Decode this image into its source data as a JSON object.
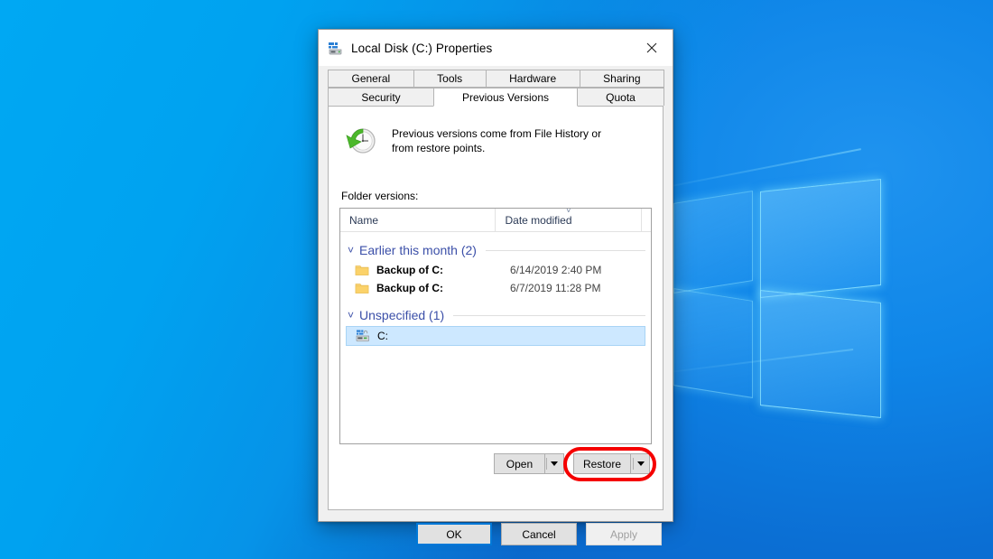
{
  "window": {
    "title": "Local Disk (C:) Properties",
    "icon": "hard-disk-icon",
    "close_label": "✕"
  },
  "tabs": {
    "row1": [
      {
        "label": "General",
        "active": false
      },
      {
        "label": "Tools",
        "active": false
      },
      {
        "label": "Hardware",
        "active": false
      },
      {
        "label": "Sharing",
        "active": false
      }
    ],
    "row2": [
      {
        "label": "Security",
        "active": false
      },
      {
        "label": "Previous Versions",
        "active": true
      },
      {
        "label": "Quota",
        "active": false
      }
    ]
  },
  "page": {
    "info_icon": "clock-restore-icon",
    "info_text": "Previous versions come from File History or from restore points.",
    "list_label": "Folder versions:"
  },
  "list": {
    "columns": [
      {
        "label": "Name",
        "sorted": false
      },
      {
        "label": "Date modified",
        "sorted": true,
        "sort_direction": "descending"
      }
    ],
    "groups": [
      {
        "label": "Earlier this month (2)",
        "expanded": true,
        "items": [
          {
            "icon": "folder-icon",
            "name": "Backup of C:",
            "date": "6/14/2019 2:40 PM",
            "selected": false
          },
          {
            "icon": "folder-icon",
            "name": "Backup of C:",
            "date": "6/7/2019 11:28 PM",
            "selected": false
          }
        ]
      },
      {
        "label": "Unspecified (1)",
        "expanded": true,
        "items": [
          {
            "icon": "drive-icon",
            "name": "C:",
            "date": "",
            "selected": true
          }
        ]
      }
    ]
  },
  "actions": {
    "open": {
      "label": "Open",
      "dropdown": true
    },
    "restore": {
      "label": "Restore",
      "dropdown": true,
      "highlighted": true
    }
  },
  "footer": {
    "ok": {
      "label": "OK",
      "default": true,
      "disabled": false
    },
    "cancel": {
      "label": "Cancel",
      "default": false,
      "disabled": false
    },
    "apply": {
      "label": "Apply",
      "default": false,
      "disabled": true
    }
  },
  "colors": {
    "accent": "#0078d7",
    "highlight_annotation": "#f50000",
    "group_header": "#3b4fa8",
    "selection": "#cde8ff",
    "desktop": "#0a78d8"
  }
}
